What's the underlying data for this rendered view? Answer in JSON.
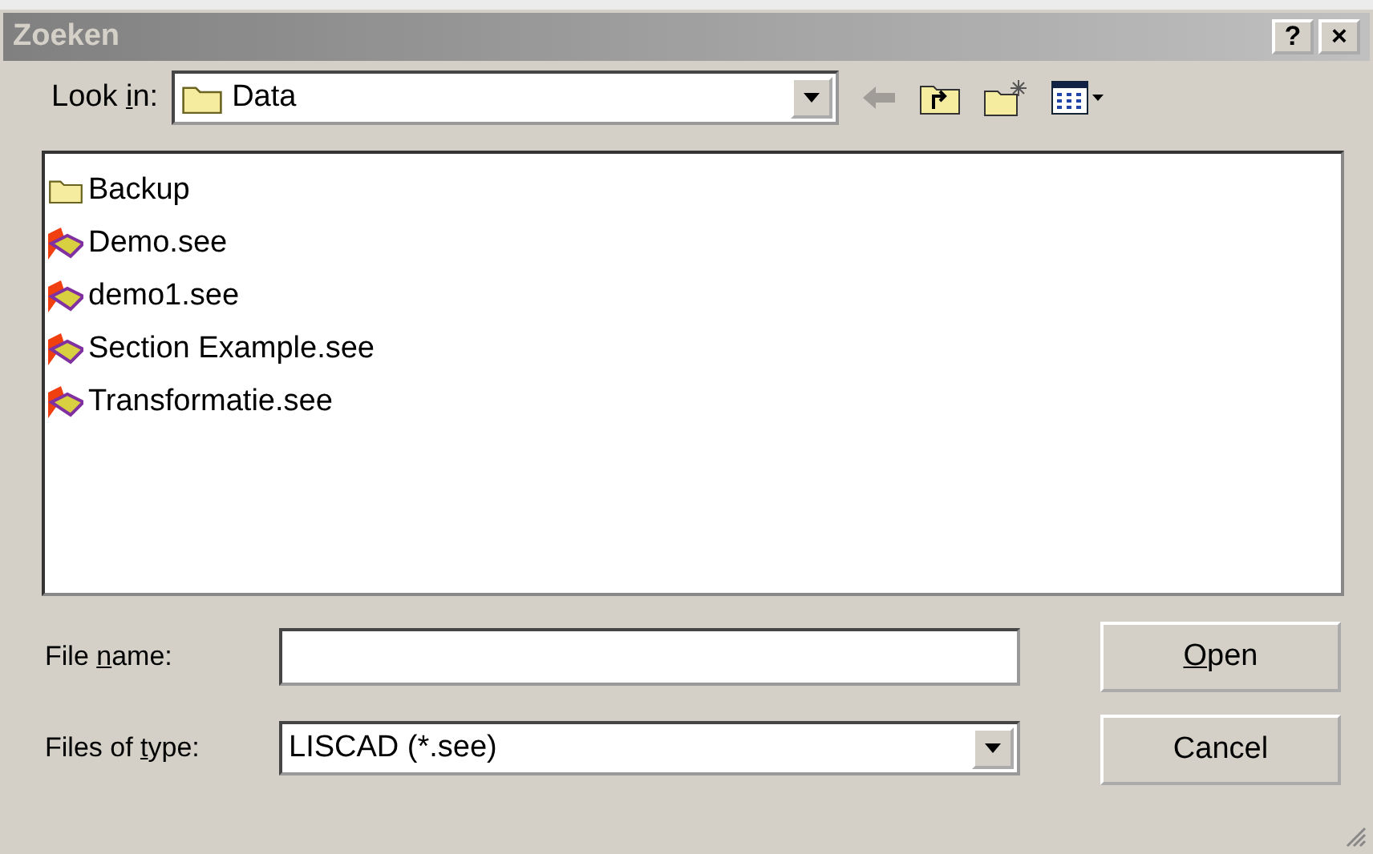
{
  "window": {
    "title": "Zoeken",
    "buttons": [
      {
        "glyph": "?"
      },
      {
        "glyph": "×"
      }
    ]
  },
  "look_in": {
    "label": {
      "pre": "Look ",
      "key": "i",
      "post": "n:"
    },
    "value": "Data"
  },
  "files": [
    {
      "kind": "folder",
      "name": "Backup"
    },
    {
      "kind": "file",
      "name": "Demo.see"
    },
    {
      "kind": "file",
      "name": "demo1.see"
    },
    {
      "kind": "file",
      "name": "Section Example.see"
    },
    {
      "kind": "file",
      "name": "Transformatie.see"
    }
  ],
  "file_name": {
    "label": {
      "pre": "File ",
      "key": "n",
      "post": "ame:"
    }
  },
  "file_type": {
    "label": {
      "pre": "Files of ",
      "key": "t",
      "post": "ype:"
    },
    "value": "LISCAD (*.see)"
  },
  "buttons": [
    {
      "label": {
        "key": "O",
        "post": "pen"
      }
    },
    {
      "label": {
        "pre": "Cancel"
      }
    }
  ]
}
